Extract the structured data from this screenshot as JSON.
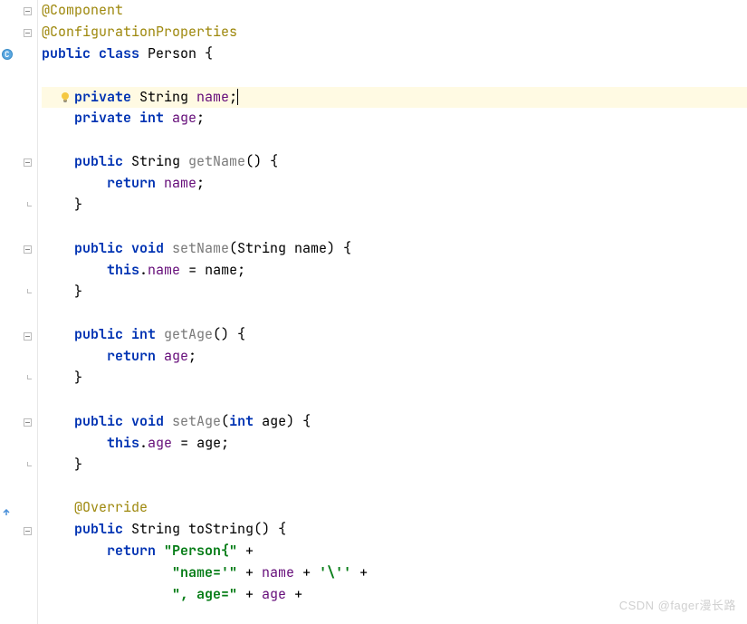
{
  "code": {
    "lines": [
      {
        "tokens": [
          {
            "cls": "annotation",
            "t": "@Component"
          }
        ],
        "foldStart": true
      },
      {
        "tokens": [
          {
            "cls": "annotation",
            "t": "@ConfigurationProperties"
          }
        ],
        "foldStart": true
      },
      {
        "tokens": [
          {
            "cls": "kw",
            "t": "public class "
          },
          {
            "cls": "type",
            "t": "Person "
          },
          {
            "cls": "punct",
            "t": "{"
          }
        ],
        "classMarker": true
      },
      {
        "tokens": []
      },
      {
        "tokens": [
          {
            "cls": "",
            "t": "    "
          },
          {
            "cls": "kw",
            "t": "private "
          },
          {
            "cls": "type",
            "t": "String "
          },
          {
            "cls": "field",
            "t": "name"
          },
          {
            "cls": "punct",
            "t": ";"
          }
        ],
        "highlighted": true,
        "cursor": true,
        "bulb": true
      },
      {
        "tokens": [
          {
            "cls": "",
            "t": "    "
          },
          {
            "cls": "kw",
            "t": "private int "
          },
          {
            "cls": "field",
            "t": "age"
          },
          {
            "cls": "punct",
            "t": ";"
          }
        ]
      },
      {
        "tokens": []
      },
      {
        "tokens": [
          {
            "cls": "",
            "t": "    "
          },
          {
            "cls": "kw",
            "t": "public "
          },
          {
            "cls": "type",
            "t": "String "
          },
          {
            "cls": "method-decl",
            "t": "getName"
          },
          {
            "cls": "punct",
            "t": "() {"
          }
        ],
        "foldStart": true
      },
      {
        "tokens": [
          {
            "cls": "",
            "t": "        "
          },
          {
            "cls": "kw",
            "t": "return "
          },
          {
            "cls": "field",
            "t": "name"
          },
          {
            "cls": "punct",
            "t": ";"
          }
        ]
      },
      {
        "tokens": [
          {
            "cls": "",
            "t": "    "
          },
          {
            "cls": "punct",
            "t": "}"
          }
        ],
        "foldEnd": true
      },
      {
        "tokens": []
      },
      {
        "tokens": [
          {
            "cls": "",
            "t": "    "
          },
          {
            "cls": "kw",
            "t": "public void "
          },
          {
            "cls": "method-decl",
            "t": "setName"
          },
          {
            "cls": "punct",
            "t": "(String name) {"
          }
        ],
        "foldStart": true
      },
      {
        "tokens": [
          {
            "cls": "",
            "t": "        "
          },
          {
            "cls": "kw",
            "t": "this"
          },
          {
            "cls": "punct",
            "t": "."
          },
          {
            "cls": "field",
            "t": "name"
          },
          {
            "cls": "punct",
            "t": " = name;"
          }
        ]
      },
      {
        "tokens": [
          {
            "cls": "",
            "t": "    "
          },
          {
            "cls": "punct",
            "t": "}"
          }
        ],
        "foldEnd": true
      },
      {
        "tokens": []
      },
      {
        "tokens": [
          {
            "cls": "",
            "t": "    "
          },
          {
            "cls": "kw",
            "t": "public int "
          },
          {
            "cls": "method-decl",
            "t": "getAge"
          },
          {
            "cls": "punct",
            "t": "() {"
          }
        ],
        "foldStart": true
      },
      {
        "tokens": [
          {
            "cls": "",
            "t": "        "
          },
          {
            "cls": "kw",
            "t": "return "
          },
          {
            "cls": "field",
            "t": "age"
          },
          {
            "cls": "punct",
            "t": ";"
          }
        ]
      },
      {
        "tokens": [
          {
            "cls": "",
            "t": "    "
          },
          {
            "cls": "punct",
            "t": "}"
          }
        ],
        "foldEnd": true
      },
      {
        "tokens": []
      },
      {
        "tokens": [
          {
            "cls": "",
            "t": "    "
          },
          {
            "cls": "kw",
            "t": "public void "
          },
          {
            "cls": "method-decl",
            "t": "setAge"
          },
          {
            "cls": "punct",
            "t": "("
          },
          {
            "cls": "kw",
            "t": "int"
          },
          {
            "cls": "punct",
            "t": " age) {"
          }
        ],
        "foldStart": true
      },
      {
        "tokens": [
          {
            "cls": "",
            "t": "        "
          },
          {
            "cls": "kw",
            "t": "this"
          },
          {
            "cls": "punct",
            "t": "."
          },
          {
            "cls": "field",
            "t": "age"
          },
          {
            "cls": "punct",
            "t": " = age;"
          }
        ]
      },
      {
        "tokens": [
          {
            "cls": "",
            "t": "    "
          },
          {
            "cls": "punct",
            "t": "}"
          }
        ],
        "foldEnd": true
      },
      {
        "tokens": []
      },
      {
        "tokens": [
          {
            "cls": "",
            "t": "    "
          },
          {
            "cls": "annotation",
            "t": "@Override"
          }
        ],
        "override": true
      },
      {
        "tokens": [
          {
            "cls": "",
            "t": "    "
          },
          {
            "cls": "kw",
            "t": "public "
          },
          {
            "cls": "type",
            "t": "String "
          },
          {
            "cls": "type",
            "t": "toString"
          },
          {
            "cls": "punct",
            "t": "() {"
          }
        ],
        "foldStart": true
      },
      {
        "tokens": [
          {
            "cls": "",
            "t": "        "
          },
          {
            "cls": "kw",
            "t": "return "
          },
          {
            "cls": "str",
            "t": "\"Person{\" "
          },
          {
            "cls": "punct",
            "t": "+"
          }
        ]
      },
      {
        "tokens": [
          {
            "cls": "",
            "t": "                "
          },
          {
            "cls": "str",
            "t": "\"name='\" "
          },
          {
            "cls": "punct",
            "t": "+ "
          },
          {
            "cls": "field",
            "t": "name"
          },
          {
            "cls": "punct",
            "t": " + "
          },
          {
            "cls": "char-lit",
            "t": "'\\'' "
          },
          {
            "cls": "punct",
            "t": "+"
          }
        ]
      },
      {
        "tokens": [
          {
            "cls": "",
            "t": "                "
          },
          {
            "cls": "str",
            "t": "\", age=\" "
          },
          {
            "cls": "punct",
            "t": "+ "
          },
          {
            "cls": "field",
            "t": "age"
          },
          {
            "cls": "punct",
            "t": " +"
          }
        ]
      }
    ]
  },
  "watermark": "CSDN @fager漫长路"
}
